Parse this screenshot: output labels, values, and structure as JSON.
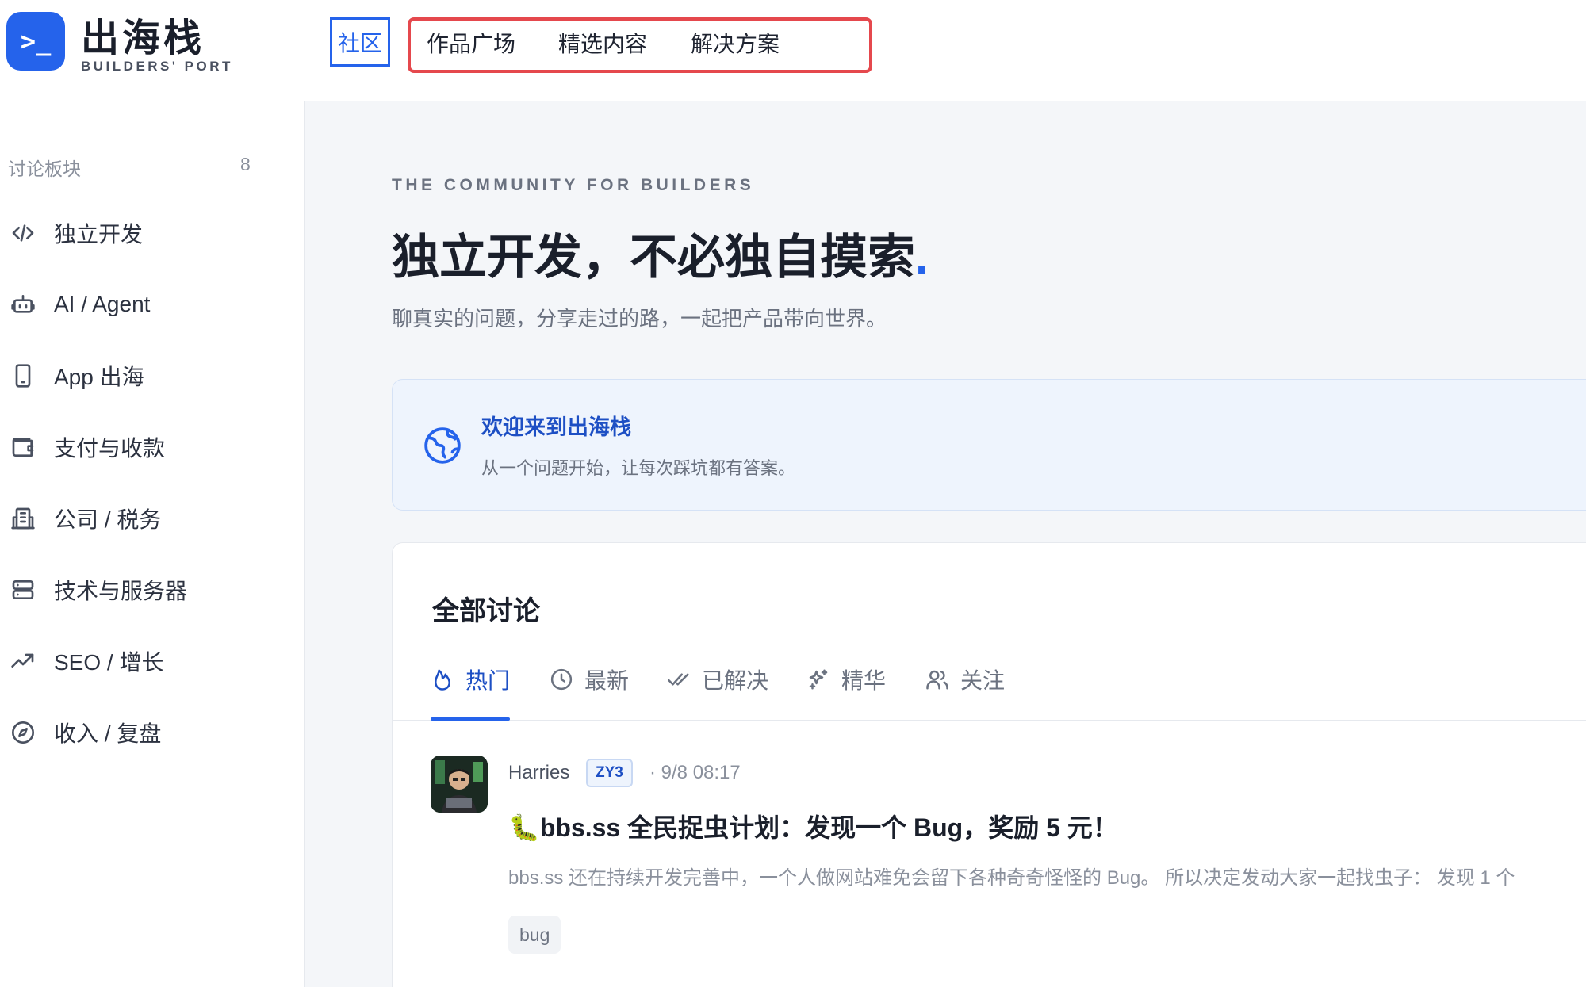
{
  "brand": {
    "logo_glyph": ">_",
    "title": "出海栈",
    "subtitle": "BUILDERS' PORT",
    "color": "#2563eb"
  },
  "nav": {
    "community": "社区",
    "items": [
      "作品广场",
      "精选内容",
      "解决方案"
    ],
    "highlight_color": "#e5484d"
  },
  "sidebar": {
    "heading": "讨论板块",
    "count": "8",
    "items": [
      {
        "label": "独立开发",
        "icon": "code-icon"
      },
      {
        "label": "AI / Agent",
        "icon": "robot-icon"
      },
      {
        "label": "App 出海",
        "icon": "smartphone-icon"
      },
      {
        "label": "支付与收款",
        "icon": "wallet-icon"
      },
      {
        "label": "公司 / 税务",
        "icon": "building-icon"
      },
      {
        "label": "技术与服务器",
        "icon": "server-icon"
      },
      {
        "label": "SEO / 增长",
        "icon": "trending-up-icon"
      },
      {
        "label": "收入 / 复盘",
        "icon": "compass-icon"
      }
    ]
  },
  "main": {
    "tagline": "THE COMMUNITY FOR BUILDERS",
    "hero": "独立开发，不必独自摸索",
    "hero_dot": ".",
    "hero_sub": "聊真实的问题，分享走过的路，一起把产品带向世界。",
    "welcome": {
      "title": "欢迎来到出海栈",
      "text": "从一个问题开始，让每次踩坑都有答案。",
      "icon": "globe-icon"
    },
    "panel": {
      "title": "全部讨论",
      "tabs": [
        {
          "label": "热门",
          "icon": "flame-icon",
          "active": true
        },
        {
          "label": "最新",
          "icon": "clock-icon",
          "active": false
        },
        {
          "label": "已解决",
          "icon": "double-check-icon",
          "active": false
        },
        {
          "label": "精华",
          "icon": "sparkles-icon",
          "active": false
        },
        {
          "label": "关注",
          "icon": "users-icon",
          "active": false
        }
      ]
    },
    "post": {
      "author": "Harries",
      "badge": "ZY3",
      "time": "· 9/8 08:17",
      "emoji": "🐛",
      "title": "bbs.ss 全民捉虫计划：发现一个 Bug，奖励 5 元！",
      "excerpt": "bbs.ss 还在持续开发完善中，一个人做网站难免会留下各种奇奇怪怪的 Bug。 所以决定发动大家一起找虫子： 发现 1 个",
      "tag": "bug"
    }
  }
}
